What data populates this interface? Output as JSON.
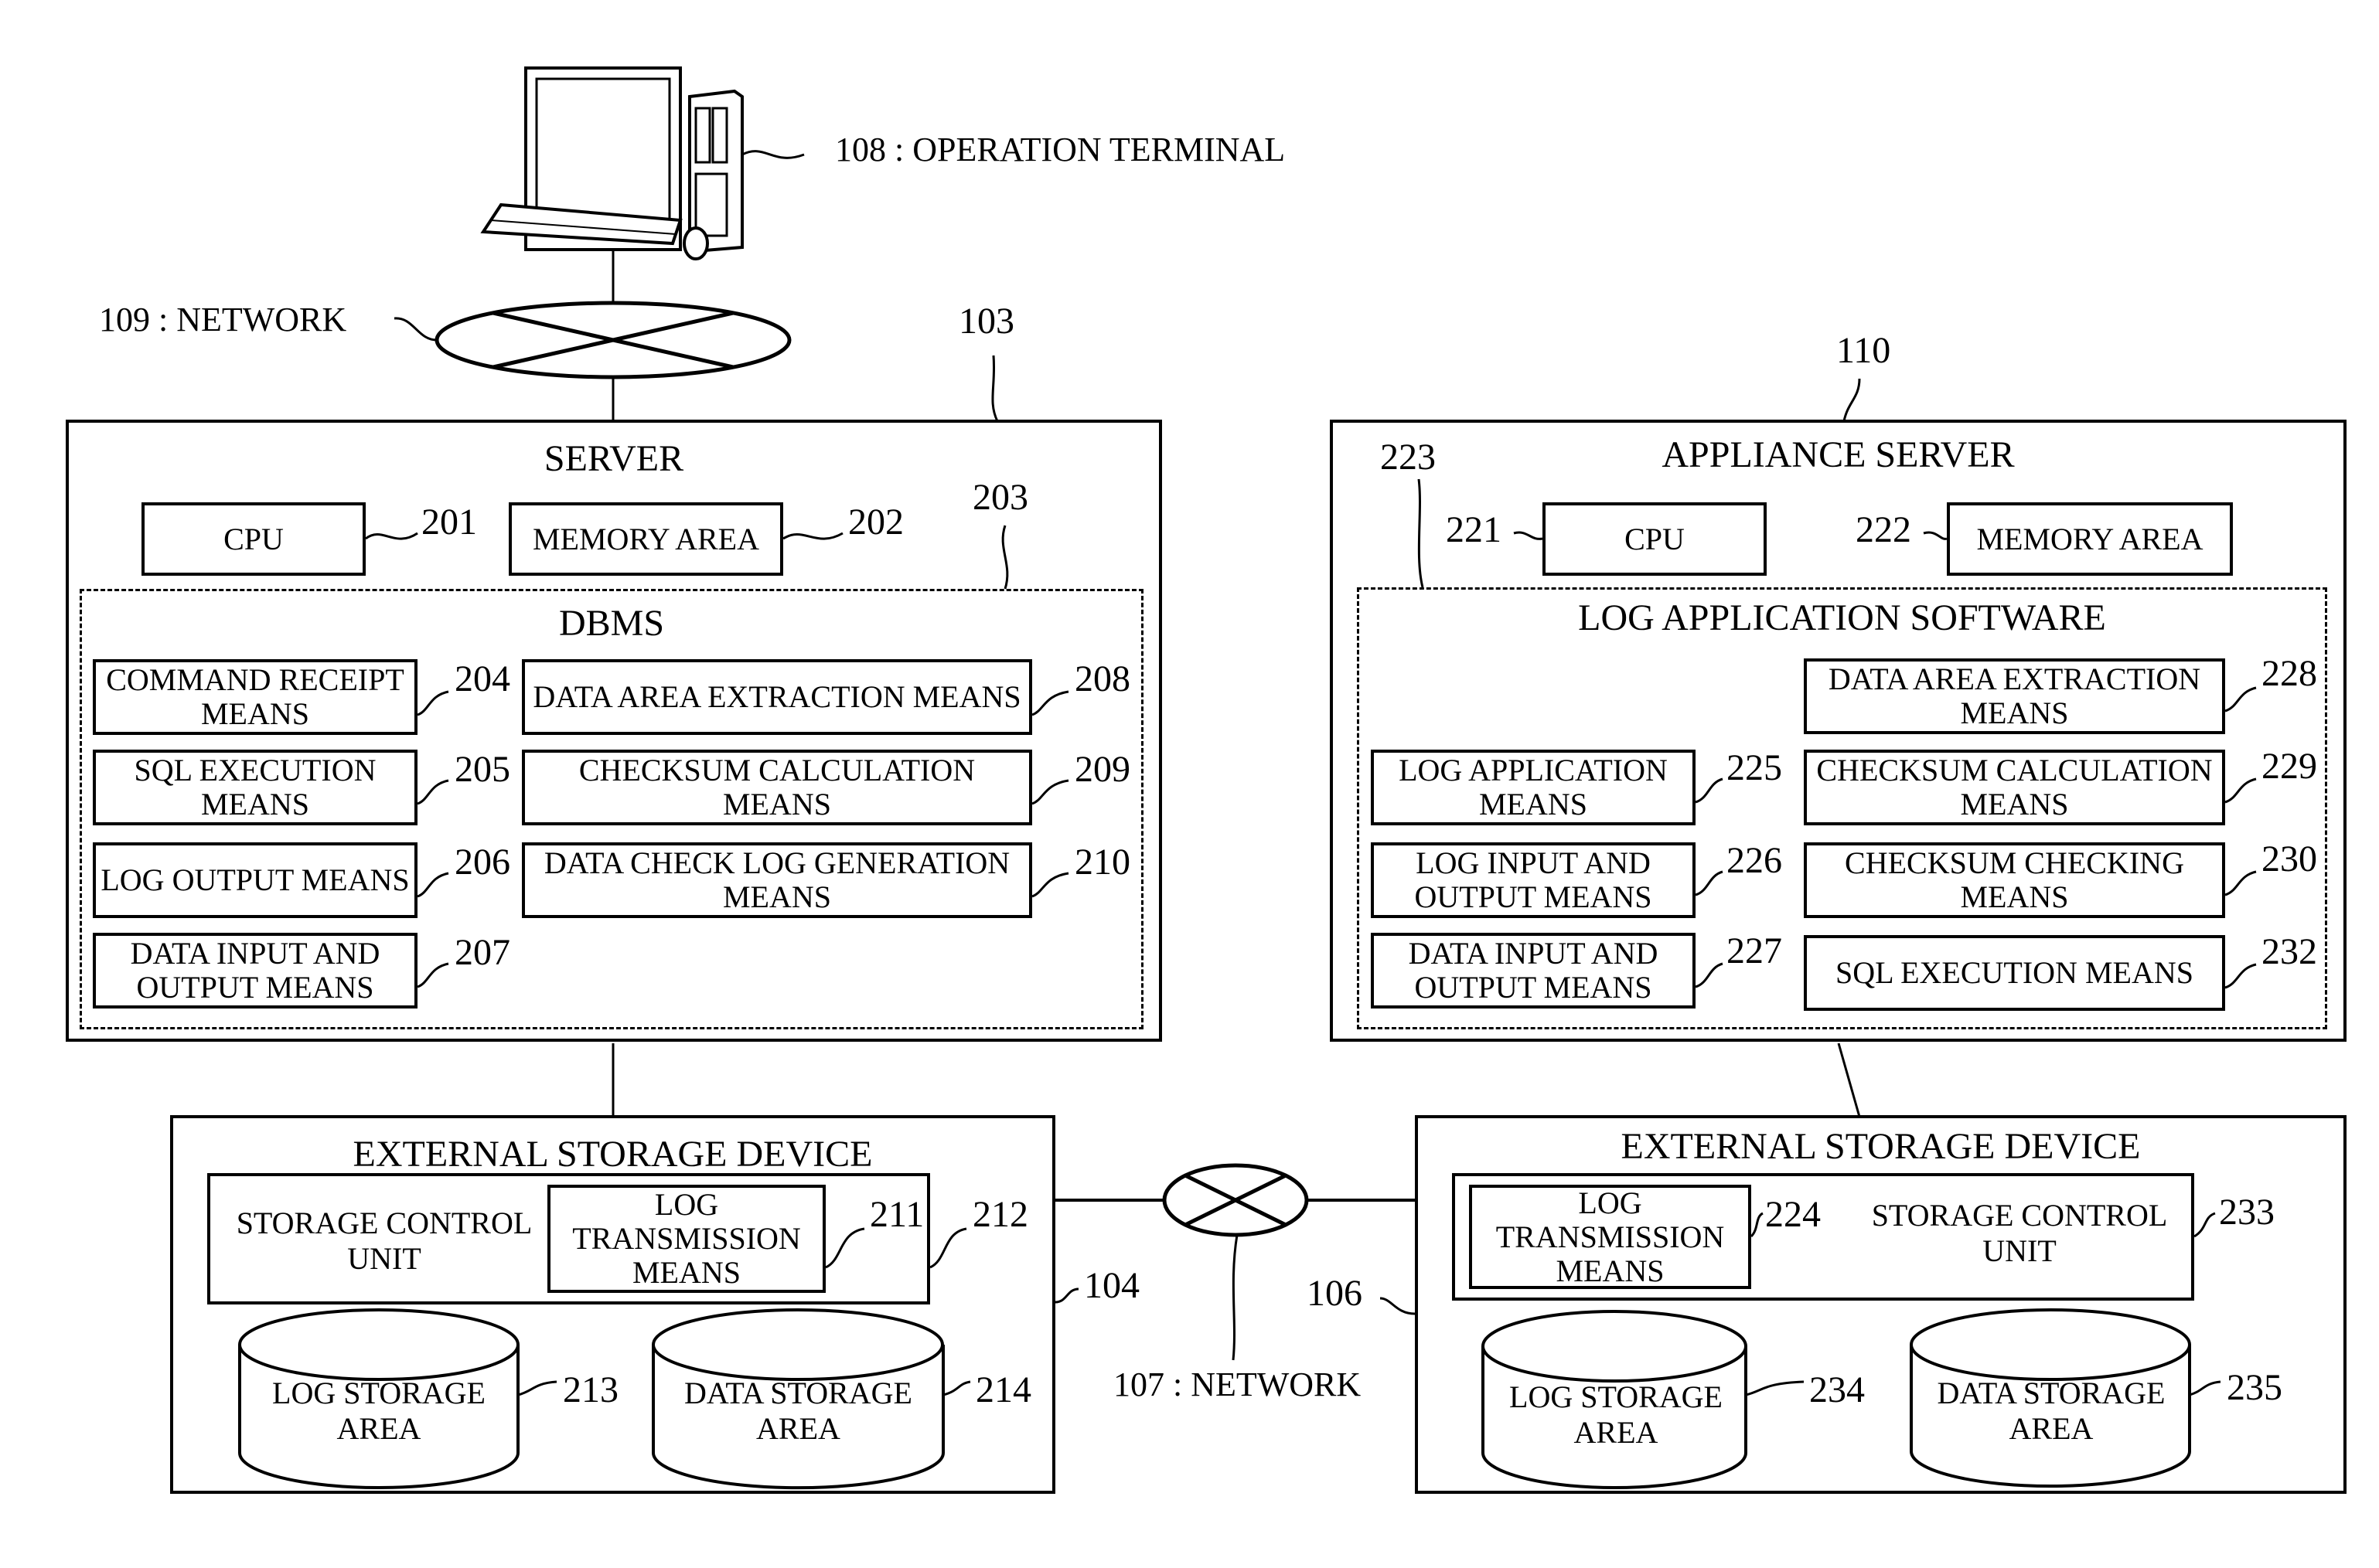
{
  "terminal": {
    "label": "108 : OPERATION TERMINAL"
  },
  "network_top": {
    "label": "109 : NETWORK"
  },
  "network_bottom": {
    "label": "107 : NETWORK"
  },
  "server": {
    "ref": "103",
    "title": "SERVER",
    "cpu": {
      "label": "CPU",
      "ref": "201"
    },
    "memory": {
      "label": "MEMORY AREA",
      "ref": "202"
    },
    "dbms": {
      "ref": "203",
      "title": "DBMS",
      "left": [
        {
          "label": "COMMAND RECEIPT MEANS",
          "ref": "204"
        },
        {
          "label": "SQL EXECUTION MEANS",
          "ref": "205"
        },
        {
          "label": "LOG OUTPUT MEANS",
          "ref": "206"
        },
        {
          "label": "DATA INPUT AND OUTPUT MEANS",
          "ref": "207"
        }
      ],
      "right": [
        {
          "label": "DATA AREA EXTRACTION MEANS",
          "ref": "208"
        },
        {
          "label": "CHECKSUM CALCULATION MEANS",
          "ref": "209"
        },
        {
          "label": "DATA CHECK LOG GENERATION MEANS",
          "ref": "210"
        }
      ]
    }
  },
  "appliance": {
    "ref": "110",
    "title": "APPLIANCE SERVER",
    "cpu": {
      "label": "CPU",
      "ref": "221"
    },
    "memory": {
      "label": "MEMORY AREA",
      "ref": "222"
    },
    "software": {
      "ref": "223",
      "title": "LOG APPLICATION SOFTWARE",
      "left": [
        {
          "label": "LOG APPLICATION MEANS",
          "ref": "225"
        },
        {
          "label": "LOG INPUT AND OUTPUT MEANS",
          "ref": "226"
        },
        {
          "label": "DATA INPUT AND OUTPUT MEANS",
          "ref": "227"
        }
      ],
      "right": [
        {
          "label": "DATA AREA EXTRACTION MEANS",
          "ref": "228"
        },
        {
          "label": "CHECKSUM CALCULATION MEANS",
          "ref": "229"
        },
        {
          "label": "CHECKSUM CHECKING MEANS",
          "ref": "230"
        },
        {
          "label": "SQL EXECUTION MEANS",
          "ref": "232"
        }
      ]
    }
  },
  "storage_left": {
    "ref": "104",
    "title": "EXTERNAL STORAGE DEVICE",
    "control_unit": {
      "label": "STORAGE CONTROL UNIT",
      "ref": "212"
    },
    "log_transmission": {
      "label": "LOG TRANSMISSION MEANS",
      "ref": "211"
    },
    "log_storage": {
      "label": "LOG STORAGE AREA",
      "ref": "213"
    },
    "data_storage": {
      "label": "DATA STORAGE AREA",
      "ref": "214"
    }
  },
  "storage_right": {
    "ref": "106",
    "title": "EXTERNAL STORAGE DEVICE",
    "control_unit": {
      "label": "STORAGE CONTROL UNIT",
      "ref": "233"
    },
    "log_transmission": {
      "label": "LOG TRANSMISSION MEANS",
      "ref": "224"
    },
    "log_storage": {
      "label": "LOG STORAGE AREA",
      "ref": "234"
    },
    "data_storage": {
      "label": "DATA STORAGE AREA",
      "ref": "235"
    }
  }
}
